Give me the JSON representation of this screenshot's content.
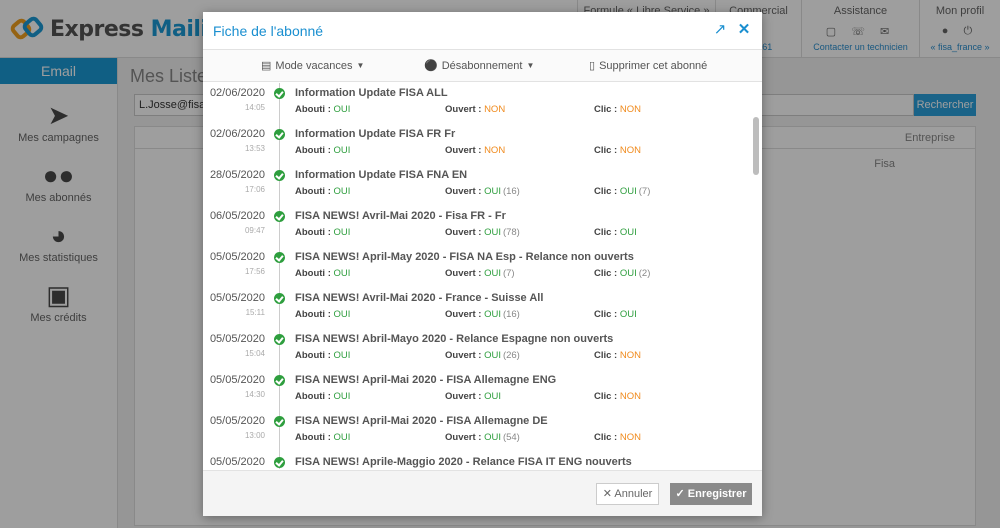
{
  "app": {
    "brand_a": "Express ",
    "brand_b": "Mailing",
    "top": {
      "formule": "Formule « Libre Service »",
      "commercial": "Commercial",
      "commercial_sub": "13.961",
      "assistance": "Assistance",
      "assistance_sub": "Contacter un technicien",
      "profil": "Mon profil",
      "profil_sub": "« fisa_france »"
    },
    "sidebar": {
      "tab": "Email",
      "items": [
        "Mes campagnes",
        "Mes abonnés",
        "Mes statistiques",
        "Mes crédits"
      ]
    },
    "main": {
      "title": "Mes Liste",
      "search_value": "L.Josse@fisa.c",
      "search_button": "Rechercher",
      "col_header": "Entreprise",
      "cell": "Fisa"
    }
  },
  "modal": {
    "title": "Fiche de l'abonné",
    "toolbar": {
      "vacances": "Mode vacances",
      "desabonnement": "Désabonnement",
      "supprimer": "Supprimer cet abonné"
    },
    "labels": {
      "abouti": "Abouti : ",
      "ouvert": "Ouvert : ",
      "clic": "Clic : "
    },
    "entries": [
      {
        "date": "02/06/2020",
        "time": "14:05",
        "subject": "Information Update FISA ALL",
        "abouti": "OUI",
        "ouvert": "NON",
        "ouvert_count": "",
        "clic": "NON",
        "clic_count": ""
      },
      {
        "date": "02/06/2020",
        "time": "13:53",
        "subject": "Information Update FISA FR Fr",
        "abouti": "OUI",
        "ouvert": "NON",
        "ouvert_count": "",
        "clic": "NON",
        "clic_count": ""
      },
      {
        "date": "28/05/2020",
        "time": "17:06",
        "subject": "Information Update FISA FNA EN",
        "abouti": "OUI",
        "ouvert": "OUI",
        "ouvert_count": "(16)",
        "clic": "OUI",
        "clic_count": "(7)"
      },
      {
        "date": "06/05/2020",
        "time": "09:47",
        "subject": "FISA NEWS! Avril-Mai 2020 - Fisa FR - Fr",
        "abouti": "OUI",
        "ouvert": "OUI",
        "ouvert_count": "(78)",
        "clic": "OUI",
        "clic_count": ""
      },
      {
        "date": "05/05/2020",
        "time": "17:56",
        "subject": "FISA NEWS! April-May 2020 - FISA NA Esp - Relance non ouverts",
        "abouti": "OUI",
        "ouvert": "OUI",
        "ouvert_count": "(7)",
        "clic": "OUI",
        "clic_count": "(2)"
      },
      {
        "date": "05/05/2020",
        "time": "15:11",
        "subject": "FISA NEWS! Avril-Mai 2020 - France - Suisse All",
        "abouti": "OUI",
        "ouvert": "OUI",
        "ouvert_count": "(16)",
        "clic": "OUI",
        "clic_count": ""
      },
      {
        "date": "05/05/2020",
        "time": "15:04",
        "subject": "FISA NEWS! Abril-Mayo 2020 - Relance Espagne non ouverts",
        "abouti": "OUI",
        "ouvert": "OUI",
        "ouvert_count": "(26)",
        "clic": "NON",
        "clic_count": ""
      },
      {
        "date": "05/05/2020",
        "time": "14:30",
        "subject": "FISA NEWS! April-Mai 2020 - FISA Allemagne ENG",
        "abouti": "OUI",
        "ouvert": "OUI",
        "ouvert_count": "",
        "clic": "NON",
        "clic_count": ""
      },
      {
        "date": "05/05/2020",
        "time": "13:00",
        "subject": "FISA NEWS! April-Mai 2020 - FISA Allemagne DE",
        "abouti": "OUI",
        "ouvert": "OUI",
        "ouvert_count": "(54)",
        "clic": "NON",
        "clic_count": ""
      },
      {
        "date": "05/05/2020",
        "time": "",
        "subject": "FISA NEWS! Aprile-Maggio 2020 - Relance FISA IT ENG nouverts",
        "abouti": "",
        "ouvert": "",
        "ouvert_count": "",
        "clic": "",
        "clic_count": ""
      }
    ],
    "footer": {
      "cancel": "Annuler",
      "save": "Enregistrer"
    }
  }
}
